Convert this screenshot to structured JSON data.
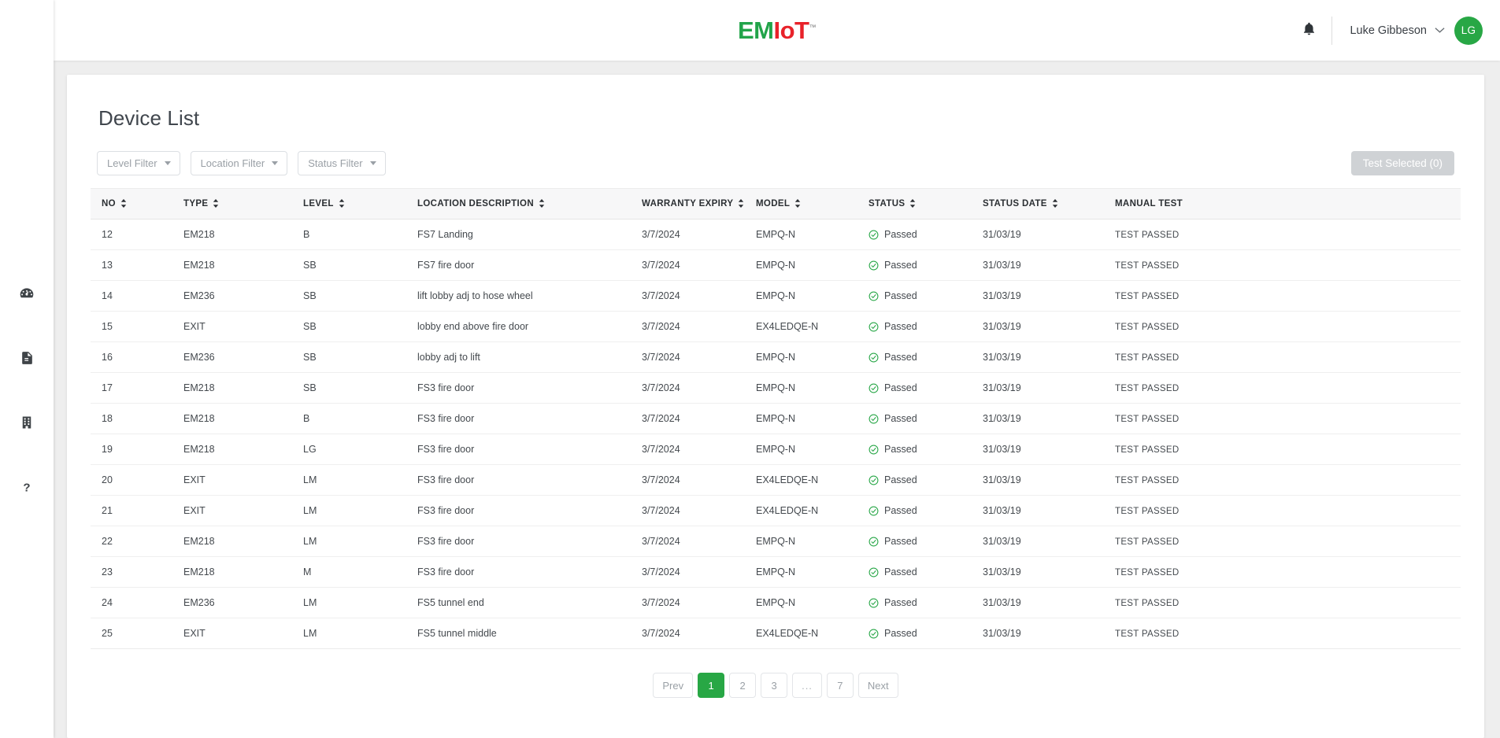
{
  "brand": {
    "logo_part1": "EM",
    "logo_part2": "IoT",
    "trademark": "™",
    "green": "#22a44a",
    "red": "#e8222a",
    "accent_green": "#28a745"
  },
  "sidebar": {
    "items": [
      {
        "name": "dashboard",
        "icon": "gauge-icon"
      },
      {
        "name": "reports",
        "icon": "document-icon"
      },
      {
        "name": "buildings",
        "icon": "building-icon"
      },
      {
        "name": "help",
        "icon": "question-mark-icon"
      }
    ]
  },
  "topbar": {
    "notifications_icon": "bell-icon",
    "user_name": "Luke Gibbeson",
    "user_initials": "LG",
    "chevron_icon": "chevron-down-icon"
  },
  "page": {
    "title": "Device List"
  },
  "filters": [
    {
      "label": "Level Filter"
    },
    {
      "label": "Location Filter"
    },
    {
      "label": "Status Filter"
    }
  ],
  "actions": {
    "test_selected_label": "Test Selected (0)",
    "test_selected_disabled": true
  },
  "table": {
    "columns": [
      {
        "key": "no",
        "label": "NO",
        "sortable": true
      },
      {
        "key": "type",
        "label": "TYPE",
        "sortable": true
      },
      {
        "key": "level",
        "label": "LEVEL",
        "sortable": true
      },
      {
        "key": "loc",
        "label": "LOCATION DESCRIPTION",
        "sortable": true
      },
      {
        "key": "warr",
        "label": "WARRANTY EXPIRY",
        "sortable": true
      },
      {
        "key": "model",
        "label": "MODEL",
        "sortable": true
      },
      {
        "key": "status",
        "label": "STATUS",
        "sortable": true
      },
      {
        "key": "sdate",
        "label": "STATUS DATE",
        "sortable": true
      },
      {
        "key": "manual",
        "label": "MANUAL TEST",
        "sortable": false
      }
    ],
    "rows": [
      {
        "no": "12",
        "type": "EM218",
        "level": "B",
        "loc": "FS7 Landing",
        "warr": "3/7/2024",
        "model": "EMPQ-N",
        "status": "Passed",
        "sdate": "31/03/19",
        "manual": "TEST PASSED"
      },
      {
        "no": "13",
        "type": "EM218",
        "level": "SB",
        "loc": "FS7 fire door",
        "warr": "3/7/2024",
        "model": "EMPQ-N",
        "status": "Passed",
        "sdate": "31/03/19",
        "manual": "TEST PASSED"
      },
      {
        "no": "14",
        "type": "EM236",
        "level": "SB",
        "loc": "lift lobby adj to hose wheel",
        "warr": "3/7/2024",
        "model": "EMPQ-N",
        "status": "Passed",
        "sdate": "31/03/19",
        "manual": "TEST PASSED"
      },
      {
        "no": "15",
        "type": "EXIT",
        "level": "SB",
        "loc": "lobby end above fire door",
        "warr": "3/7/2024",
        "model": "EX4LEDQE-N",
        "status": "Passed",
        "sdate": "31/03/19",
        "manual": "TEST PASSED"
      },
      {
        "no": "16",
        "type": "EM236",
        "level": "SB",
        "loc": "lobby adj to lift",
        "warr": "3/7/2024",
        "model": "EMPQ-N",
        "status": "Passed",
        "sdate": "31/03/19",
        "manual": "TEST PASSED"
      },
      {
        "no": "17",
        "type": "EM218",
        "level": "SB",
        "loc": "FS3 fire door",
        "warr": "3/7/2024",
        "model": "EMPQ-N",
        "status": "Passed",
        "sdate": "31/03/19",
        "manual": "TEST PASSED"
      },
      {
        "no": "18",
        "type": "EM218",
        "level": "B",
        "loc": "FS3 fire door",
        "warr": "3/7/2024",
        "model": "EMPQ-N",
        "status": "Passed",
        "sdate": "31/03/19",
        "manual": "TEST PASSED"
      },
      {
        "no": "19",
        "type": "EM218",
        "level": "LG",
        "loc": "FS3 fire door",
        "warr": "3/7/2024",
        "model": "EMPQ-N",
        "status": "Passed",
        "sdate": "31/03/19",
        "manual": "TEST PASSED"
      },
      {
        "no": "20",
        "type": "EXIT",
        "level": "LM",
        "loc": "FS3 fire door",
        "warr": "3/7/2024",
        "model": "EX4LEDQE-N",
        "status": "Passed",
        "sdate": "31/03/19",
        "manual": "TEST PASSED"
      },
      {
        "no": "21",
        "type": "EXIT",
        "level": "LM",
        "loc": "FS3 fire door",
        "warr": "3/7/2024",
        "model": "EX4LEDQE-N",
        "status": "Passed",
        "sdate": "31/03/19",
        "manual": "TEST PASSED"
      },
      {
        "no": "22",
        "type": "EM218",
        "level": "LM",
        "loc": "FS3 fire door",
        "warr": "3/7/2024",
        "model": "EMPQ-N",
        "status": "Passed",
        "sdate": "31/03/19",
        "manual": "TEST PASSED"
      },
      {
        "no": "23",
        "type": "EM218",
        "level": "M",
        "loc": "FS3 fire door",
        "warr": "3/7/2024",
        "model": "EMPQ-N",
        "status": "Passed",
        "sdate": "31/03/19",
        "manual": "TEST PASSED"
      },
      {
        "no": "24",
        "type": "EM236",
        "level": "LM",
        "loc": "FS5 tunnel end",
        "warr": "3/7/2024",
        "model": "EMPQ-N",
        "status": "Passed",
        "sdate": "31/03/19",
        "manual": "TEST PASSED"
      },
      {
        "no": "25",
        "type": "EXIT",
        "level": "LM",
        "loc": "FS5 tunnel middle",
        "warr": "3/7/2024",
        "model": "EX4LEDQE-N",
        "status": "Passed",
        "sdate": "31/03/19",
        "manual": "TEST PASSED"
      }
    ]
  },
  "pagination": {
    "prev_label": "Prev",
    "next_label": "Next",
    "pages": [
      "1",
      "2",
      "3",
      "...",
      "7"
    ],
    "active_page": "1"
  }
}
